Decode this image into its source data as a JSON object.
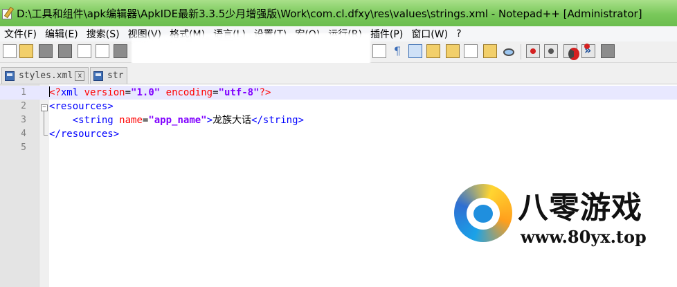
{
  "window": {
    "title": "D:\\工具和组件\\apk编辑器\\ApkIDE最新3.3.5少月增强版\\Work\\com.cl.dfxy\\res\\values\\strings.xml - Notepad++ [Administrator]"
  },
  "menu": {
    "items": [
      "文件(F)",
      "编辑(E)",
      "搜索(S)",
      "视图(V)",
      "格式(M)",
      "语言(L)",
      "设置(T)",
      "宏(O)",
      "运行(R)",
      "插件(P)",
      "窗口(W)",
      "?"
    ]
  },
  "tabs": [
    {
      "label": "styles.xml",
      "close": "x"
    },
    {
      "label": "str",
      "close": ""
    }
  ],
  "editor": {
    "line_numbers": [
      "1",
      "2",
      "3",
      "4",
      "5"
    ],
    "lines": [
      {
        "pi_open": "<?",
        "tag": "xml",
        "attr1": "version",
        "eq": "=",
        "val1": "\"1.0\"",
        "attr2": "encoding",
        "val2": "\"utf-8\"",
        "pi_close": "?>"
      },
      {
        "tag_open": "<resources>"
      },
      {
        "indent": "    ",
        "tag_start": "<string",
        "attr": "name",
        "eq": "=",
        "val": "\"app_name\"",
        "gt": ">",
        "text": "龙族大话",
        "tag_end": "</string>"
      },
      {
        "tag_close": "</resources>"
      },
      {}
    ]
  },
  "watermark": {
    "title": "八零游戏",
    "url": "www.80yx.top"
  },
  "icons": [
    "notepad-app-icon",
    "new-file-icon",
    "open-file-icon",
    "save-icon",
    "save-all-icon",
    "close-icon",
    "close-all-icon",
    "print-icon",
    "word-wrap-icon",
    "show-all-chars-icon",
    "indent-guide-icon",
    "doc-map-icon",
    "function-list-icon",
    "folder-workspace-icon",
    "monitor-icon",
    "record-macro-icon",
    "stop-macro-icon",
    "play-macro-icon",
    "run-macro-multiple-icon",
    "save-macro-icon",
    "disk-icon"
  ]
}
